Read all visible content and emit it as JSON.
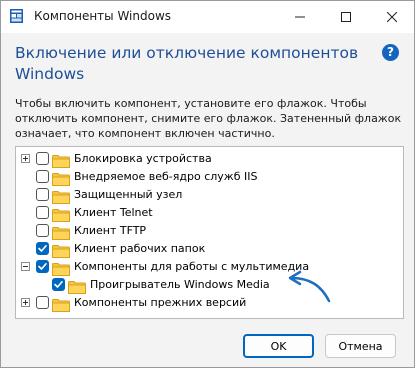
{
  "window": {
    "title": "Компоненты Windows",
    "heading_line1": "Включение или отключение компонентов",
    "heading_line2": "Windows",
    "help": "?",
    "description_lines": [
      "Чтобы включить компонент, установите его флажок. Чтобы",
      "отключить компонент, снимите его флажок. Затененный флажок",
      "означает, что компонент включен частично."
    ]
  },
  "tree": {
    "items": [
      {
        "label": "Блокировка устройства",
        "expander": "plus",
        "checked": false
      },
      {
        "label": "Внедряемое веб-ядро служб IIS",
        "expander": "none",
        "checked": false
      },
      {
        "label": "Защищенный узел",
        "expander": "none",
        "checked": false
      },
      {
        "label": "Клиент Telnet",
        "expander": "none",
        "checked": false
      },
      {
        "label": "Клиент TFTP",
        "expander": "none",
        "checked": false
      },
      {
        "label": "Клиент рабочих папок",
        "expander": "none",
        "checked": true
      },
      {
        "label": "Компоненты для работы с мультимедиа",
        "expander": "minus",
        "checked": true
      },
      {
        "label": "Проигрыватель Windows Media",
        "expander": "none",
        "checked": true,
        "child": true
      },
      {
        "label": "Компоненты прежних версий",
        "expander": "plus",
        "checked": false
      }
    ]
  },
  "buttons": {
    "ok": "OK",
    "cancel": "Отмена"
  },
  "colors": {
    "heading": "#1f4e98",
    "checkbox_checked": "#0067c0",
    "folder": "#f6c443",
    "arrow": "#1f6fbf"
  }
}
